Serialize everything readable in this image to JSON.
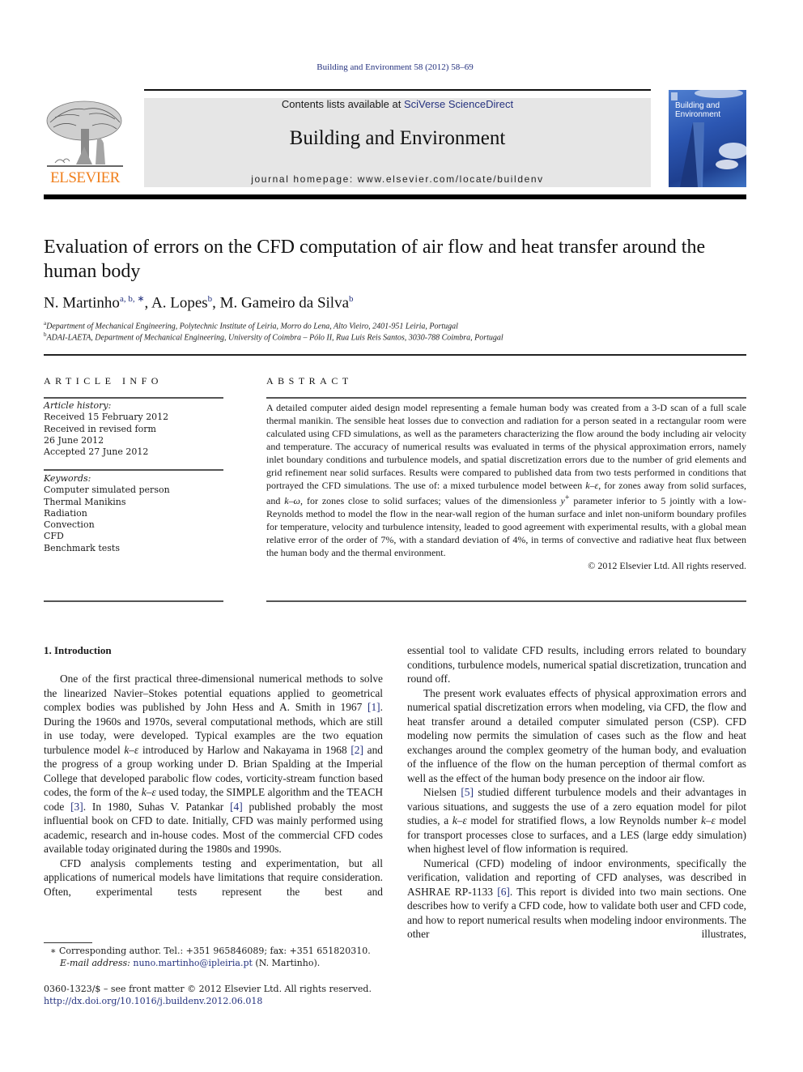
{
  "journal_ref": "Building and Environment 58 (2012) 58–69",
  "header": {
    "contents_prefix": "Contents lists available at ",
    "contents_link": "SciVerse ScienceDirect",
    "journal_title": "Building and Environment",
    "homepage": "journal homepage: www.elsevier.com/locate/buildenv",
    "publisher_logo_text": "ELSEVIER",
    "cover_title_line1": "Building and",
    "cover_title_line2": "Environment"
  },
  "colors": {
    "link": "#25327f",
    "elsevier_orange": "#f07f1c",
    "header_bg": "#e6e6e6"
  },
  "article": {
    "title": "Evaluation of errors on the CFD computation of air flow and heat transfer around the human body",
    "authors": [
      {
        "name": "N. Martinho",
        "sup": "a, b, ∗"
      },
      {
        "name": "A. Lopes",
        "sup": "b"
      },
      {
        "name": "M. Gameiro da Silva",
        "sup": "b"
      }
    ],
    "affiliations": [
      {
        "mark": "a",
        "text": "Department of Mechanical Engineering, Polytechnic Institute of Leiria, Morro do Lena, Alto Vieiro, 2401-951 Leiria, Portugal"
      },
      {
        "mark": "b",
        "text": "ADAI-LAETA, Department of Mechanical Engineering, University of Coimbra – Pólo II, Rua Luis Reis Santos, 3030-788 Coimbra, Portugal"
      }
    ]
  },
  "article_info": {
    "heading": "ARTICLE INFO",
    "history_label": "Article history:",
    "history": [
      "Received 15 February 2012",
      "Received in revised form",
      "26 June 2012",
      "Accepted 27 June 2012"
    ],
    "keywords_label": "Keywords:",
    "keywords": [
      "Computer simulated person",
      "Thermal Manikins",
      "Radiation",
      "Convection",
      "CFD",
      "Benchmark tests"
    ]
  },
  "abstract": {
    "heading": "ABSTRACT",
    "text_part1": "A detailed computer aided design model representing a female human body was created from a 3-D scan of a full scale thermal manikin. The sensible heat losses due to convection and radiation for a person seated in a rectangular room were calculated using CFD simulations, as well as the parameters characterizing the flow around the body including air velocity and temperature. The accuracy of numerical results was evaluated in terms of the physical approximation errors, namely inlet boundary conditions and turbulence models, and spatial discretization errors due to the number of grid elements and grid refinement near solid surfaces. Results were compared to published data from two tests performed in conditions that portrayed the CFD simulations. The use of: a mixed turbulence model between ",
    "ke": "k–ε",
    "text_part2": ", for zones away from solid surfaces, and ",
    "kw": "k–ω",
    "text_part3": ", for zones close to solid surfaces; values of the dimensionless ",
    "yplus": "y",
    "yplus_sup": "+",
    "text_part4": " parameter inferior to 5 jointly with a low-Reynolds method to model the flow in the near-wall region of the human surface and inlet non-uniform boundary profiles for temperature, velocity and turbulence intensity, leaded to good agreement with experimental results, with a global mean relative error of the order of 7%, with a standard deviation of 4%, in terms of convective and radiative heat flux between the human body and the thermal environment.",
    "copyright": "© 2012 Elsevier Ltd. All rights reserved."
  },
  "introduction": {
    "heading": "1.  Introduction",
    "p1_a": "One of the first practical three-dimensional numerical methods to solve the linearized Navier–Stokes potential equations applied to geometrical complex bodies was published by John Hess and A. Smith in 1967 ",
    "ref1": "[1]",
    "p1_b": ". During the 1960s and 1970s, several computational methods, which are still in use today, were developed. Typical examples are the two equation turbulence model ",
    "ke": "k–ε",
    "p1_c": " introduced by Harlow and Nakayama in 1968 ",
    "ref2": "[2]",
    "p1_d": " and the progress of a group working under D. Brian Spalding at the Imperial College that developed parabolic flow codes, vorticity-stream function based codes, the form of the ",
    "p1_e": " used today, the SIMPLE algorithm and the TEACH code ",
    "ref3": "[3]",
    "p1_f": ". In 1980, Suhas V. Patankar ",
    "ref4": "[4]",
    "p1_g": " published probably the most influential book on CFD to date. Initially, CFD was mainly performed using academic, research and in-house codes. Most of the commercial CFD codes available today originated during the 1980s and 1990s.",
    "p2": "CFD analysis complements testing and experimentation, but all applications of numerical models have limitations that require consideration. Often, experimental tests represent the best and essential tool to validate CFD results, including errors related to boundary conditions, turbulence models, numerical spatial discretization, truncation and round off.",
    "p2_left": "CFD analysis complements testing and experimentation, but all applications of numerical models have limitations that require consideration. Often, experimental tests represent the best and",
    "p2_right": "essential tool to validate CFD results, including errors related to boundary conditions, turbulence models, numerical spatial discretization, truncation and round off.",
    "p3": "The present work evaluates effects of physical approximation errors and numerical spatial discretization errors when modeling, via CFD, the flow and heat transfer around a detailed computer simulated person (CSP). CFD modeling now permits the simulation of cases such as the flow and heat exchanges around the complex geometry of the human body, and evaluation of the influence of the flow on the human perception of thermal comfort as well as the effect of the human body presence on the indoor air flow.",
    "p4_a": "Nielsen ",
    "ref5": "[5]",
    "p4_b": " studied different turbulence models and their advantages in various situations, and suggests the use of a zero equation model for pilot studies, a ",
    "p4_c": " model for stratified flows, a low Reynolds number ",
    "p4_d": " model for transport processes close to surfaces, and a LES (large eddy simulation) when highest level of flow information is required.",
    "p5_a": "Numerical (CFD) modeling of indoor environments, specifically the verification, validation and reporting of CFD analyses, was described in ASHRAE RP-1133 ",
    "ref6": "[6]",
    "p5_b": ". This report is divided into two main sections. One describes how to verify a CFD code, how to validate both user and CFD code, and how to report numerical results when modeling indoor environments. The other illustrates,"
  },
  "footnote": {
    "mark": "∗",
    "text": " Corresponding author. Tel.: +351 965846089; fax: +351 651820310.",
    "email_label": "E-mail address: ",
    "email": "nuno.martinho@ipleiria.pt",
    "email_suffix": " (N. Martinho)."
  },
  "front_matter": {
    "issn_line": "0360-1323/$ – see front matter © 2012 Elsevier Ltd. All rights reserved.",
    "doi": "http://dx.doi.org/10.1016/j.buildenv.2012.06.018"
  }
}
